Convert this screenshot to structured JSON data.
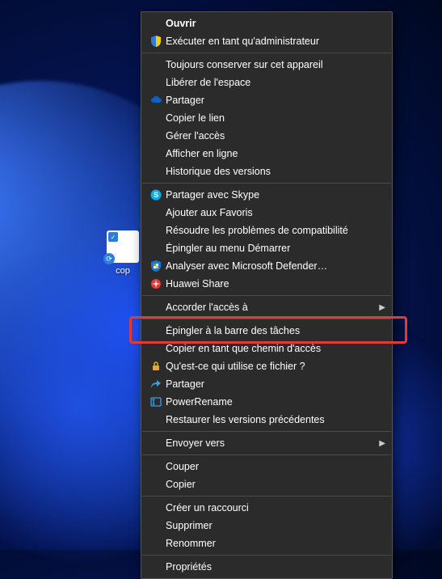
{
  "desktop_icon": {
    "label": "cop"
  },
  "menu": {
    "groups": [
      [
        {
          "id": "open",
          "label": "Ouvrir",
          "bold": true
        },
        {
          "id": "run-as-admin",
          "label": "Exécuter en tant qu'administrateur",
          "icon": "shield"
        }
      ],
      [
        {
          "id": "always-keep",
          "label": "Toujours conserver sur cet appareil"
        },
        {
          "id": "free-space",
          "label": "Libérer de l'espace"
        },
        {
          "id": "share-onedrive",
          "label": "Partager",
          "icon": "onedrive"
        },
        {
          "id": "copy-link",
          "label": "Copier le lien"
        },
        {
          "id": "manage-access",
          "label": "Gérer l'accès"
        },
        {
          "id": "view-online",
          "label": "Afficher en ligne"
        },
        {
          "id": "version-history",
          "label": "Historique des versions"
        }
      ],
      [
        {
          "id": "share-skype",
          "label": "Partager avec Skype",
          "icon": "skype"
        },
        {
          "id": "add-favorites",
          "label": "Ajouter aux Favoris"
        },
        {
          "id": "troubleshoot-compat",
          "label": "Résoudre les problèmes de compatibilité"
        },
        {
          "id": "pin-start",
          "label": "Épingler au menu Démarrer"
        },
        {
          "id": "defender-scan",
          "label": "Analyser avec Microsoft Defender…",
          "icon": "defender"
        },
        {
          "id": "huawei-share",
          "label": "Huawei Share",
          "icon": "huawei"
        }
      ],
      [
        {
          "id": "give-access",
          "label": "Accorder l'accès à",
          "submenu": true
        }
      ],
      [
        {
          "id": "pin-taskbar",
          "label": "Épingler à la barre des tâches",
          "highlight": true
        },
        {
          "id": "copy-as-path",
          "label": "Copier en tant que chemin d'accès"
        },
        {
          "id": "what-uses",
          "label": "Qu'est-ce qui utilise ce fichier ?",
          "icon": "lock"
        },
        {
          "id": "share-arrow",
          "label": "Partager",
          "icon": "share-arrow"
        },
        {
          "id": "powerrename",
          "label": "PowerRename",
          "icon": "powerrename"
        },
        {
          "id": "restore-versions",
          "label": "Restaurer les versions précédentes"
        }
      ],
      [
        {
          "id": "send-to",
          "label": "Envoyer vers",
          "submenu": true
        }
      ],
      [
        {
          "id": "cut",
          "label": "Couper"
        },
        {
          "id": "copy",
          "label": "Copier"
        }
      ],
      [
        {
          "id": "create-shortcut",
          "label": "Créer un raccourci"
        },
        {
          "id": "delete",
          "label": "Supprimer"
        },
        {
          "id": "rename",
          "label": "Renommer"
        }
      ],
      [
        {
          "id": "properties",
          "label": "Propriétés"
        }
      ]
    ]
  }
}
